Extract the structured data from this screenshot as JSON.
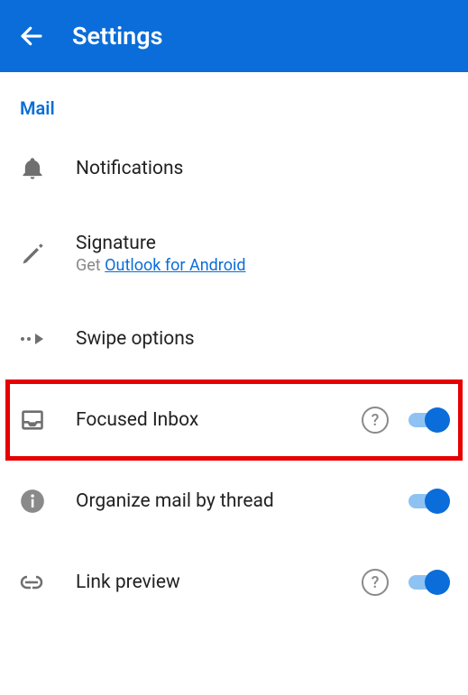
{
  "header": {
    "title": "Settings"
  },
  "section": {
    "label": "Mail"
  },
  "rows": {
    "notifications": {
      "title": "Notifications"
    },
    "signature": {
      "title": "Signature",
      "sub_prefix": "Get ",
      "sub_link": "Outlook for Android"
    },
    "swipe": {
      "title": "Swipe options"
    },
    "focused": {
      "title": "Focused Inbox",
      "toggle": true
    },
    "organize": {
      "title": "Organize mail by thread",
      "toggle": true
    },
    "link": {
      "title": "Link preview",
      "toggle": true
    }
  }
}
